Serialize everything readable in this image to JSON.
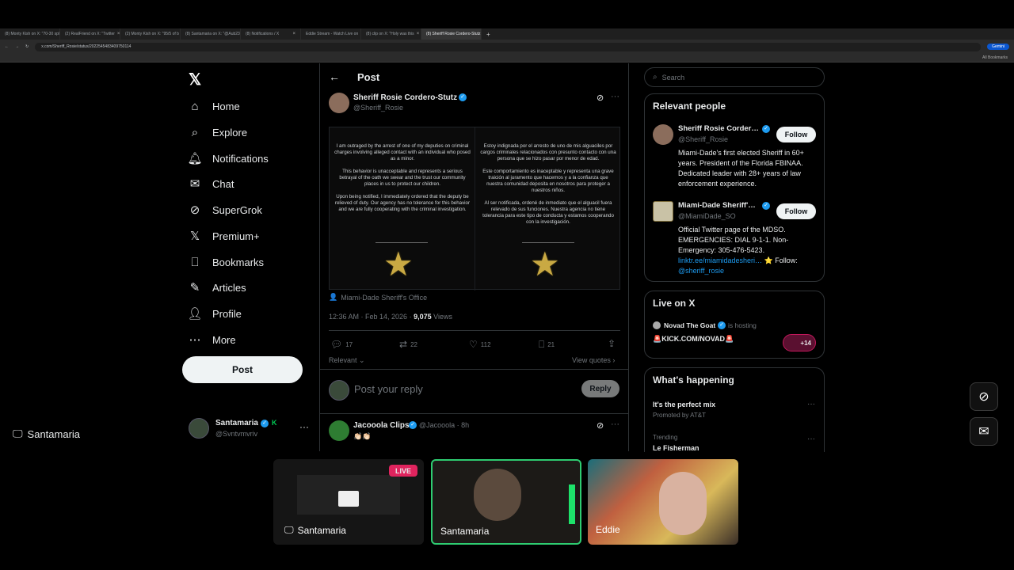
{
  "browser": {
    "tabs": [
      "(8) Monty Kish on X: \"70-30 spl",
      "(2) RealFriend on X: \"Twitter",
      "(2) Monty Kish on X: \"95/5 of b",
      "(8) Santamaria on X: \"@Aub23",
      "(8) Notifications / X",
      "Eddie Stream - Watch Live on",
      "(8) clip on X: \"Holy was this",
      "(8) Sheriff Rosie Cordero-Stutz"
    ],
    "active_tab_index": 7,
    "gemini_label": "Gemini",
    "url": "x.com/Sheriff_Rosie/status/2022545483409750114",
    "bookmarks_label": "All Bookmarks"
  },
  "nav": {
    "items": [
      {
        "label": "Home",
        "icon": "home-icon"
      },
      {
        "label": "Explore",
        "icon": "search-icon"
      },
      {
        "label": "Notifications",
        "icon": "bell-icon"
      },
      {
        "label": "Chat",
        "icon": "mail-icon"
      },
      {
        "label": "SuperGrok",
        "icon": "grok-icon"
      },
      {
        "label": "Premium+",
        "icon": "x-logo-icon"
      },
      {
        "label": "Bookmarks",
        "icon": "bookmark-icon"
      },
      {
        "label": "Articles",
        "icon": "article-icon"
      },
      {
        "label": "Profile",
        "icon": "person-icon"
      },
      {
        "label": "More",
        "icon": "more-circle-icon"
      }
    ],
    "post_label": "Post",
    "account": {
      "name": "Santamaria",
      "handle": "@Svntvmvriv"
    }
  },
  "post": {
    "header": "Post",
    "author_name": "Sheriff Rosie Cordero-Stutz",
    "author_handle": "@Sheriff_Rosie",
    "image_text_en": "I am outraged by the arrest of one of my deputies on criminal charges involving alleged contact with an individual who posed as a minor.\n\nThis behavior is unacceptable and represents a serious betrayal of the oath we swear and the trust our community places in us to protect our children.\n\nUpon being notified, I immediately ordered that the deputy be relieved of duty. Our agency has no tolerance for this behavior and we are fully cooperating with the criminal investigation.",
    "image_text_es": "Estoy indignada por el arresto de uno de mis alguaciles por cargos criminales relacionados con presunto contacto con una persona que se hizo pasar por menor de edad.\n\nEste comportamiento es inaceptable y representa una grave traición al juramento que hacemos y a la confianza que nuestra comunidad deposita en nosotros para proteger a nuestros niños.\n\nAl ser notificada, ordené de inmediato que el alguacil fuera relevado de sus funciones. Nuestra agencia no tiene tolerancia para este tipo de conducta y estamos cooperando con la investigación.",
    "tagged": "Miami-Dade Sheriff's Office",
    "timestamp": "12:36 AM · Feb 14, 2026 · ",
    "views_count": "9,075",
    "views_label": " Views",
    "replies": "17",
    "reposts": "22",
    "likes": "112",
    "bookmarks": "21",
    "sort_label": "Relevant",
    "view_quotes": "View quotes",
    "reply_placeholder": "Post your reply",
    "reply_button": "Reply"
  },
  "reply_item": {
    "name": "Jacooola Clips",
    "handle": "@Jacooola · 8h",
    "text": "👏🏻👏🏻"
  },
  "sidebar": {
    "search_placeholder": "Search",
    "relevant_title": "Relevant people",
    "people": [
      {
        "name": "Sheriff Rosie Corder…",
        "handle": "@Sheriff_Rosie",
        "bio": "Miami-Dade's first elected Sheriff in 60+ years. President of the Florida FBINAA. Dedicated leader with 28+ years of law enforcement experience.",
        "follow": "Follow"
      },
      {
        "name": "Miami-Dade Sheriff'…",
        "handle": "@MiamiDade_SO",
        "bio": "Official Twitter page of the MDSO. EMERGENCIES: DIAL 9-1-1. Non-Emergency: 305-476-5423.",
        "bio_link": "linktr.ee/miamidadesheri…",
        "bio_tail": " ⭐ Follow:",
        "bio_mention": "@sheriff_rosie",
        "follow": "Follow"
      }
    ],
    "live_title": "Live on X",
    "live_host": "Novad The Goat",
    "live_hosting": "is hosting",
    "live_stream": "🚨KICK.COM/NOVAD🚨",
    "live_count": "+14",
    "happening_title": "What's happening",
    "trend1_title": "It's the perfect mix",
    "trend1_sub": "Promoted by AT&T",
    "trend2_label": "Trending",
    "trend2_title": "Le Fisherman"
  },
  "overlay": {
    "screen_label": "Santamaria",
    "live_badge": "LIVE",
    "tiles": [
      "Santamaria",
      "Santamaria",
      "Eddie"
    ]
  }
}
